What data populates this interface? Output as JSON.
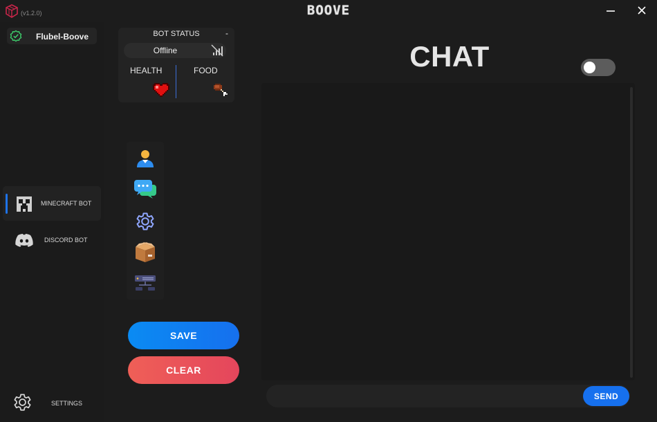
{
  "app": {
    "version": "(v1.2.0)",
    "brand": "BOOVE"
  },
  "sidebar": {
    "profile_name": "Flubel-Boove",
    "items": [
      {
        "label": "MINECRAFT BOT",
        "active": true,
        "icon": "creeper-icon"
      },
      {
        "label": "DISCORD BOT",
        "active": false,
        "icon": "discord-icon"
      }
    ],
    "settings_label": "SETTINGS"
  },
  "bot_status": {
    "title": "BOT STATUS",
    "collapse_label": "-",
    "status": "Offline",
    "health_label": "HEALTH",
    "food_label": "FOOD"
  },
  "tools": [
    "user-icon",
    "chat-bubbles-icon",
    "gear-icon",
    "box-icon",
    "server-icon"
  ],
  "buttons": {
    "save": "SAVE",
    "clear": "CLEAR"
  },
  "chat": {
    "title": "CHAT",
    "toggle_on": false,
    "input_value": "",
    "send_label": "SEND"
  },
  "colors": {
    "accent": "#1670ee",
    "danger": "#e4465c",
    "online_ok": "#3ecf6c",
    "background": "#1c1c1c"
  }
}
